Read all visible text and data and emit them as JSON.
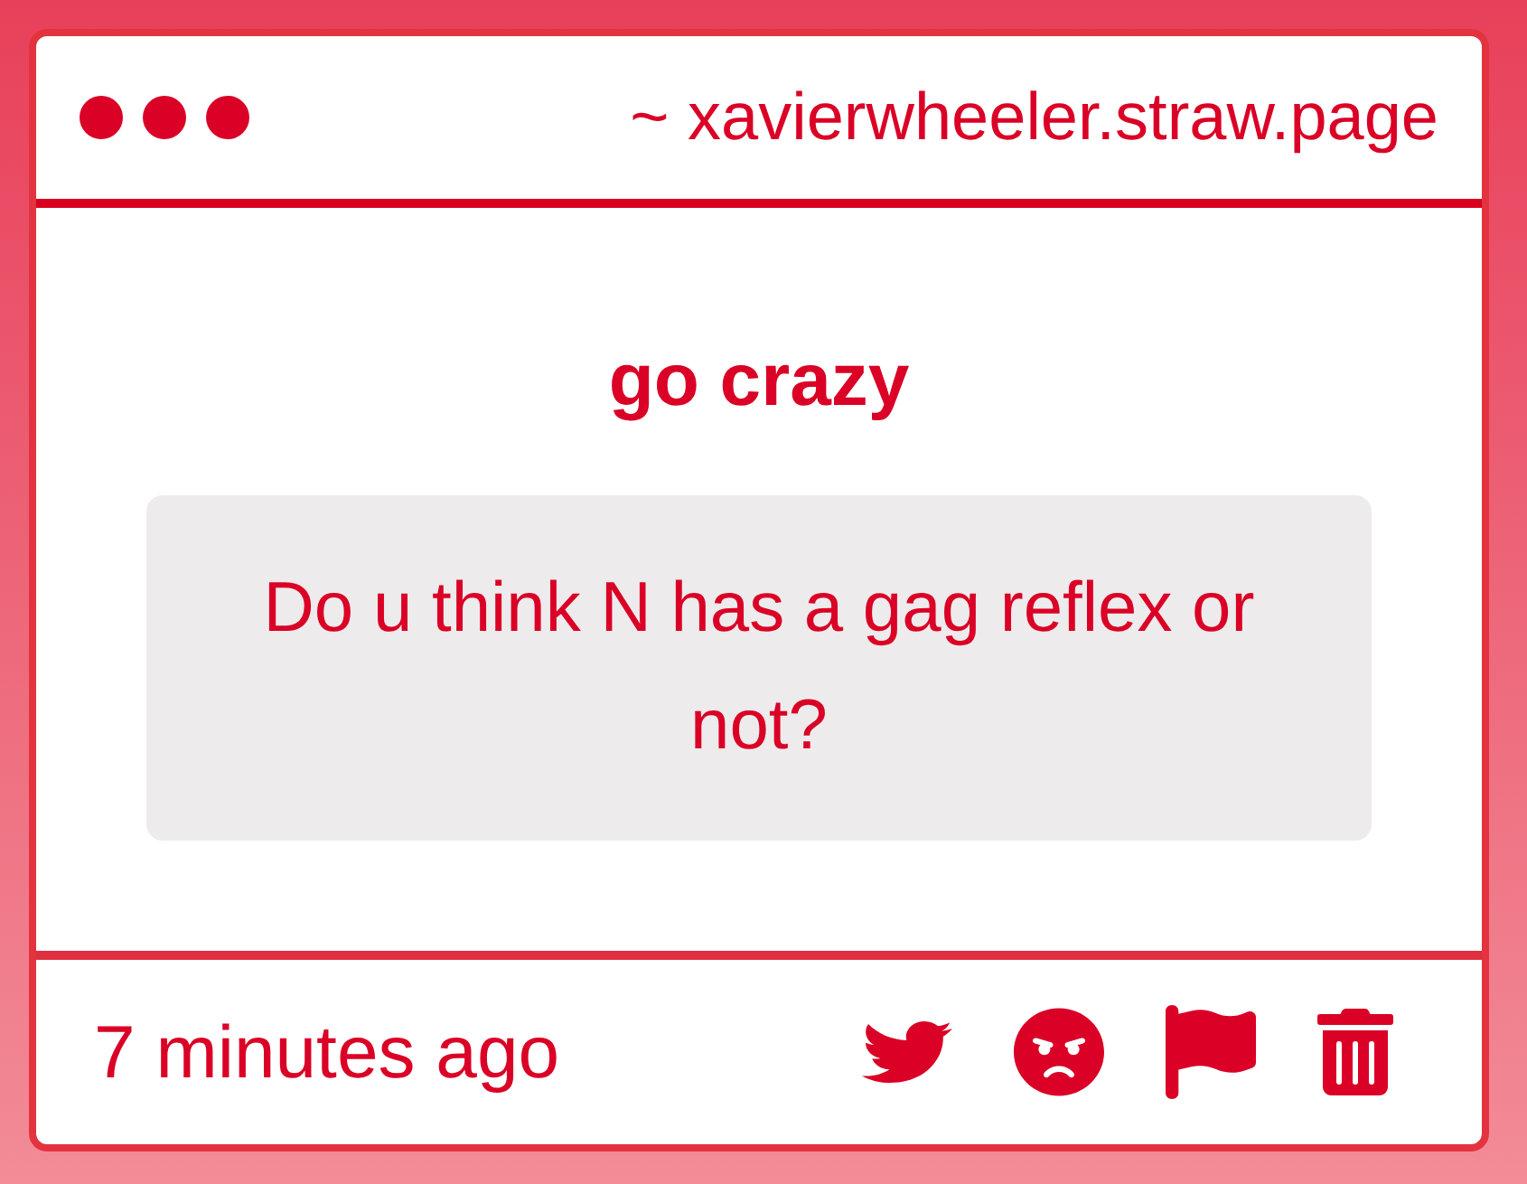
{
  "window": {
    "address": "~ xavierwheeler.straw.page"
  },
  "post": {
    "title": "go crazy",
    "question": "Do u think N has a gag reflex or not?"
  },
  "footer": {
    "time": "7 minutes ago",
    "actions": [
      {
        "kind": "twitter"
      },
      {
        "kind": "angry"
      },
      {
        "kind": "flag"
      },
      {
        "kind": "trash"
      }
    ]
  }
}
